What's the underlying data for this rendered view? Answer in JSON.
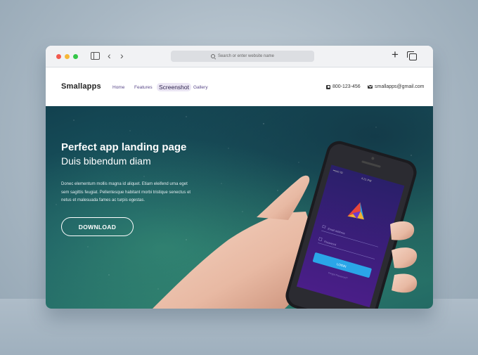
{
  "browser": {
    "url_placeholder": "Search or enter website name"
  },
  "header": {
    "brand": "Smallapps",
    "menu": [
      "Home",
      "Features",
      "Screenshot",
      "Gallery"
    ],
    "active_menu": "Screenshot",
    "phone": "800-123-456",
    "email": "smallapps@gmail.com"
  },
  "hero": {
    "title": "Perfect app landing page",
    "subtitle": "Duis bibendum diam",
    "text_lines": [
      "Donec elementum mollis magna id aliquet. Etiam eleifend urna eget",
      "sem sagittis feugiat. Pellentesque habitant morbi tristique senectus et",
      "netus et malesuada fames ac turpis egestas."
    ],
    "download_label": "DOWNLOAD"
  },
  "phone_app": {
    "status_left": "••ooo ID",
    "status_time": "4:21 PM",
    "email_placeholder": "Email address",
    "password_placeholder": "Password",
    "login_label": "LOGIN",
    "forgot_label": "Forgot Password?"
  },
  "colors": {
    "hero_top": "#12414f",
    "hero_bottom": "#2b7a6c",
    "accent_purple": "#5b4a8a",
    "login_blue": "#2aa6e8"
  }
}
